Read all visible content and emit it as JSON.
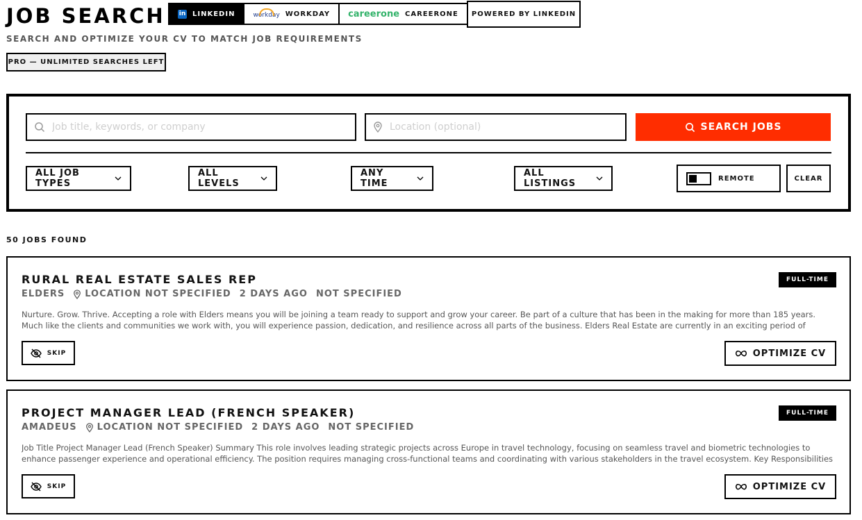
{
  "header": {
    "title": "JOB SEARCH",
    "subtitle": "SEARCH AND OPTIMIZE YOUR CV TO MATCH JOB REQUIREMENTS",
    "plan_badge": "PRO — UNLIMITED SEARCHES LEFT",
    "powered_by": "POWERED BY LINKEDIN",
    "providers": [
      {
        "label": "LINKEDIN",
        "logo_text": "in",
        "active": true
      },
      {
        "label": "WORKDAY",
        "logo_text": "workday",
        "active": false
      },
      {
        "label": "CAREERONE",
        "logo_text": "careerone",
        "active": false
      }
    ]
  },
  "search": {
    "keyword_placeholder": "Job title, keywords, or company",
    "location_placeholder": "Location (optional)",
    "search_button": "SEARCH JOBS",
    "accent_color": "#ff2d00"
  },
  "filters": {
    "job_type": "ALL JOB TYPES",
    "level": "ALL LEVELS",
    "time": "ANY TIME",
    "listings": "ALL LISTINGS",
    "remote_label": "REMOTE",
    "clear_label": "CLEAR"
  },
  "results": {
    "count_label": "50 JOBS FOUND",
    "jobs": [
      {
        "title": "RURAL REAL ESTATE SALES REP",
        "company": "ELDERS",
        "location": "LOCATION NOT SPECIFIED",
        "posted": "2 DAYS AGO",
        "salary": "NOT SPECIFIED",
        "type": "FULL-TIME",
        "description": "Nurture. Grow. Thrive. Accepting a role with Elders means you will be joining a team ready to support and grow your career. Be part of a culture that has been in the making for more than 185 years. Much like the clients and communities we work with, you will experience passion, dedication, and resilience across all parts of the business. Elders Real Estate are currently in an exciting period of expansion and growth nationally and are callin...",
        "skip_label": "SKIP",
        "optimize_label": "OPTIMIZE CV"
      },
      {
        "title": "PROJECT MANAGER LEAD (FRENCH SPEAKER)",
        "company": "AMADEUS",
        "location": "LOCATION NOT SPECIFIED",
        "posted": "2 DAYS AGO",
        "salary": "NOT SPECIFIED",
        "type": "FULL-TIME",
        "description": "Job Title Project Manager Lead (French Speaker) Summary This role involves leading strategic projects across Europe in travel technology, focusing on seamless travel and biometric technologies to enhance passenger experience and operational efficiency. The position requires managing cross-functional teams and coordinating with various stakeholders in the travel ecosystem. Key Responsibilities Guide a portfolio of strategic projects...",
        "skip_label": "SKIP",
        "optimize_label": "OPTIMIZE CV"
      }
    ]
  }
}
